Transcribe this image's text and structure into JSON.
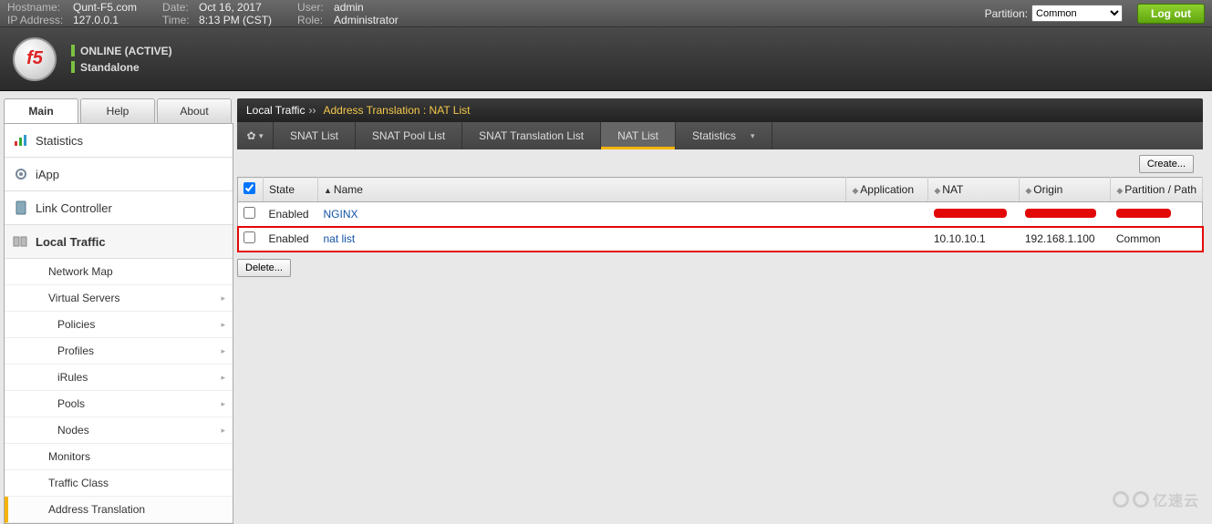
{
  "topbar": {
    "hostname_label": "Hostname:",
    "hostname": "Qunt-F5.com",
    "ip_label": "IP Address:",
    "ip": "127.0.0.1",
    "date_label": "Date:",
    "date": "Oct 16, 2017",
    "time_label": "Time:",
    "time": "8:13 PM (CST)",
    "user_label": "User:",
    "user": "admin",
    "role_label": "Role:",
    "role": "Administrator",
    "partition_label": "Partition:",
    "partition_value": "Common",
    "logout": "Log out"
  },
  "status": {
    "line1": "ONLINE (ACTIVE)",
    "line2": "Standalone",
    "logo_text": "f5"
  },
  "left_tabs": {
    "main": "Main",
    "help": "Help",
    "about": "About"
  },
  "nav": {
    "statistics": "Statistics",
    "iapp": "iApp",
    "link_controller": "Link Controller",
    "local_traffic": "Local Traffic"
  },
  "subnav": {
    "network_map": "Network Map",
    "virtual_servers": "Virtual Servers",
    "policies": "Policies",
    "profiles": "Profiles",
    "irules": "iRules",
    "pools": "Pools",
    "nodes": "Nodes",
    "monitors": "Monitors",
    "traffic_class": "Traffic Class",
    "address_translation": "Address Translation"
  },
  "breadcrumb": {
    "root": "Local Traffic",
    "path": "Address Translation : NAT List"
  },
  "tabs": {
    "snat_list": "SNAT List",
    "snat_pool_list": "SNAT Pool List",
    "snat_translation_list": "SNAT Translation List",
    "nat_list": "NAT List",
    "statistics": "Statistics"
  },
  "buttons": {
    "create": "Create...",
    "delete": "Delete..."
  },
  "table": {
    "headers": {
      "state": "State",
      "name": "Name",
      "application": "Application",
      "nat": "NAT",
      "origin": "Origin",
      "partition": "Partition / Path"
    },
    "rows": [
      {
        "state": "Enabled",
        "name": "NGINX",
        "application": "",
        "nat_redacted": true,
        "origin_redacted": true,
        "partition_redacted": true
      },
      {
        "state": "Enabled",
        "name": "nat list",
        "application": "",
        "nat": "10.10.10.1",
        "origin": "192.168.1.100",
        "partition": "Common",
        "highlight": true
      }
    ]
  },
  "watermark": "亿速云"
}
